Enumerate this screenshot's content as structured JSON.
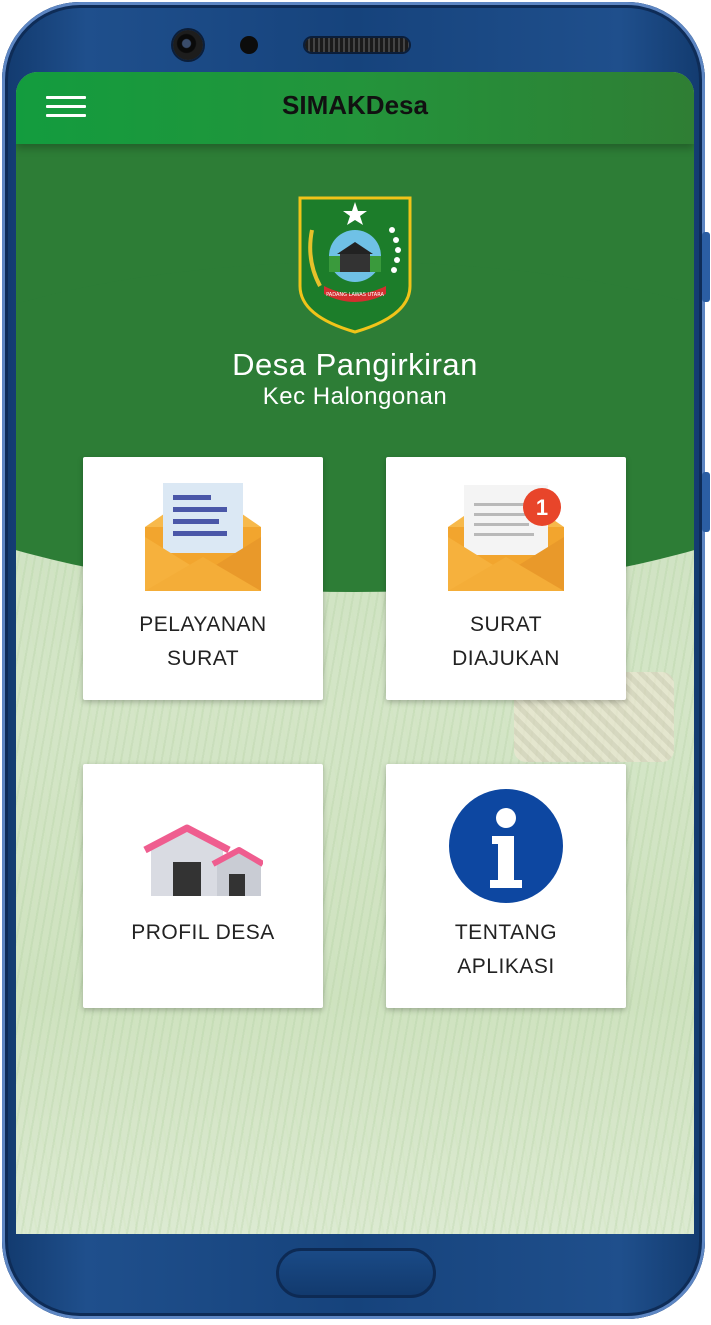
{
  "app": {
    "title": "SIMAKDesa"
  },
  "village": {
    "name": "Desa Pangirkiran",
    "district": "Kec Halongonan",
    "emblem_text": "PADANG LAWAS UTARA"
  },
  "menu": [
    {
      "line1": "PELAYANAN",
      "line2": "SURAT",
      "icon": "envelope-document-icon"
    },
    {
      "line1": "SURAT",
      "line2": "DIAJUKAN",
      "icon": "envelope-notification-icon",
      "badge": "1"
    },
    {
      "line1": "PROFIL DESA",
      "line2": "",
      "icon": "houses-icon"
    },
    {
      "line1": "TENTANG",
      "line2": "APLIKASI",
      "icon": "info-icon"
    }
  ],
  "colors": {
    "primary": "#2d7d36",
    "appbar": "#139c3e",
    "frame": "#16437c",
    "badge": "#e8452a",
    "info": "#0d47a1"
  }
}
